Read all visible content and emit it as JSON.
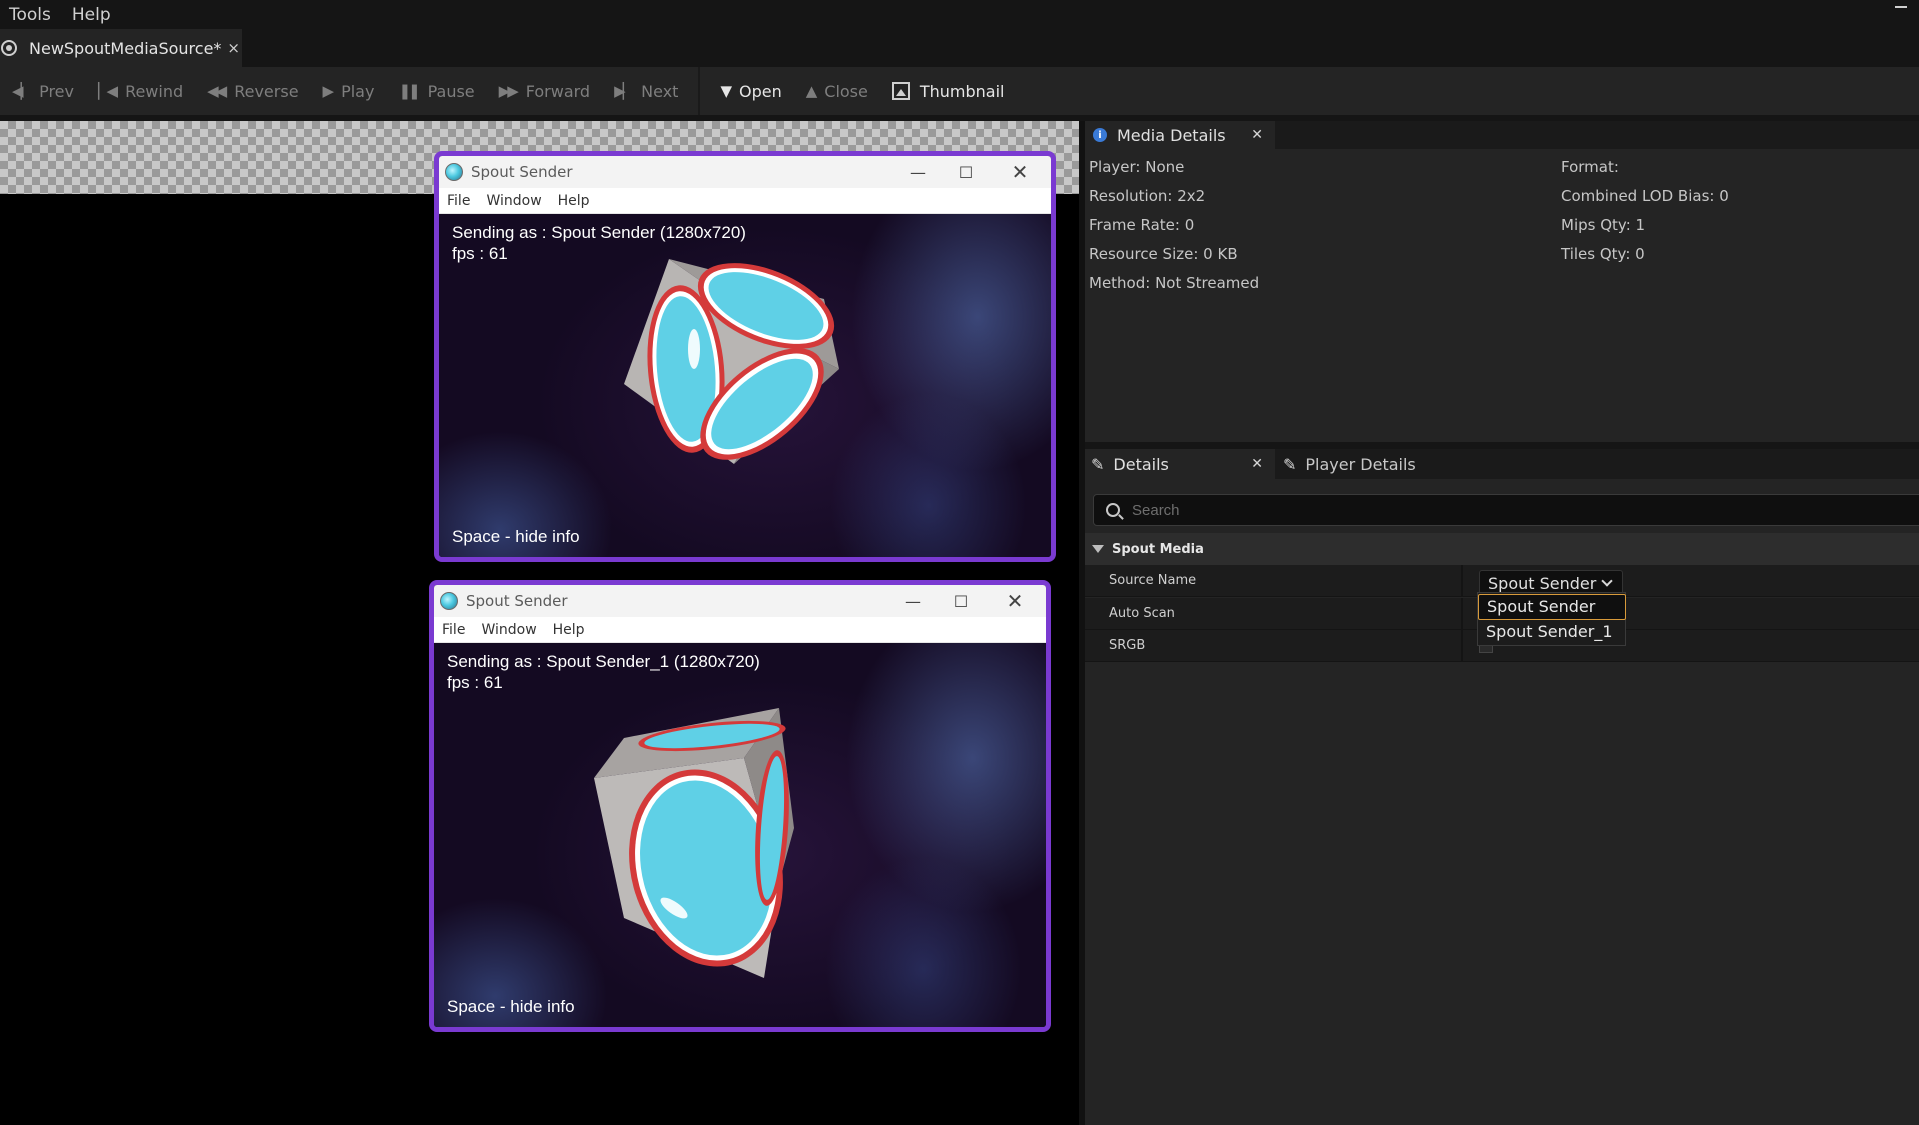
{
  "menu": {
    "tools": "Tools",
    "help": "Help"
  },
  "doc_tab": {
    "title": "NewSpoutMediaSource*",
    "close": "×"
  },
  "toolbar": {
    "prev": "Prev",
    "rewind": "Rewind",
    "reverse": "Reverse",
    "play": "Play",
    "pause": "Pause",
    "forward": "Forward",
    "next": "Next",
    "open": "Open",
    "close": "Close",
    "thumbnail": "Thumbnail"
  },
  "spout_windows": [
    {
      "title": "Spout Sender",
      "menu": [
        "File",
        "Window",
        "Help"
      ],
      "sending": "Sending as : Spout Sender (1280x720)",
      "fps": "fps : 61",
      "hint": "Space - hide info"
    },
    {
      "title": "Spout Sender",
      "menu": [
        "File",
        "Window",
        "Help"
      ],
      "sending": "Sending as : Spout Sender_1 (1280x720)",
      "fps": "fps : 61",
      "hint": "Space - hide info"
    }
  ],
  "media_details": {
    "tab": "Media Details",
    "left": [
      "Player: None",
      "Resolution: 2x2",
      "Frame Rate: 0",
      "Resource Size: 0 KB",
      "Method: Not Streamed"
    ],
    "right": [
      "Format:",
      "Combined LOD Bias: 0",
      "Mips Qty: 1",
      "Tiles Qty: 0"
    ]
  },
  "details": {
    "tab": "Details",
    "player_tab": "Player Details",
    "search_placeholder": "Search",
    "category": "Spout Media",
    "props": {
      "source_name": "Source Name",
      "auto_scan": "Auto Scan",
      "srgb": "SRGB"
    },
    "source_value": "Spout Sender",
    "options": [
      "Spout Sender",
      "Spout Sender_1"
    ]
  },
  "colors": {
    "accent_purple": "#7a3ad1",
    "selection_orange": "#d89a3a",
    "panel_bg": "#242424"
  }
}
